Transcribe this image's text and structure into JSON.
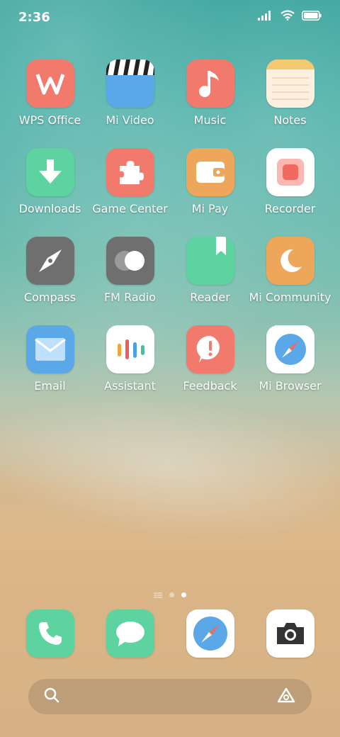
{
  "status": {
    "time": "2:36"
  },
  "apps": [
    {
      "label": "WPS Office",
      "icon": "wps-office-icon"
    },
    {
      "label": "Mi Video",
      "icon": "mi-video-icon"
    },
    {
      "label": "Music",
      "icon": "music-icon"
    },
    {
      "label": "Notes",
      "icon": "notes-icon"
    },
    {
      "label": "Downloads",
      "icon": "downloads-icon"
    },
    {
      "label": "Game Center",
      "icon": "game-center-icon"
    },
    {
      "label": "Mi Pay",
      "icon": "mi-pay-icon"
    },
    {
      "label": "Recorder",
      "icon": "recorder-icon"
    },
    {
      "label": "Compass",
      "icon": "compass-icon"
    },
    {
      "label": "FM Radio",
      "icon": "fm-radio-icon"
    },
    {
      "label": "Reader",
      "icon": "reader-icon"
    },
    {
      "label": "Mi Community",
      "icon": "mi-community-icon"
    },
    {
      "label": "Email",
      "icon": "email-icon"
    },
    {
      "label": "Assistant",
      "icon": "assistant-icon"
    },
    {
      "label": "Feedback",
      "icon": "feedback-icon"
    },
    {
      "label": "Mi Browser",
      "icon": "mi-browser-icon"
    }
  ],
  "page_indicator": {
    "pages": 2,
    "current": 2
  },
  "dock": [
    {
      "icon": "phone-icon"
    },
    {
      "icon": "messages-icon"
    },
    {
      "icon": "browser-icon"
    },
    {
      "icon": "camera-icon"
    }
  ],
  "colors": {
    "coral": "#f27a6c",
    "green": "#5dd3a0",
    "orange": "#eea75a",
    "gray": "#6f6f6f",
    "blue": "#5aa8e8",
    "white": "#ffffff"
  }
}
